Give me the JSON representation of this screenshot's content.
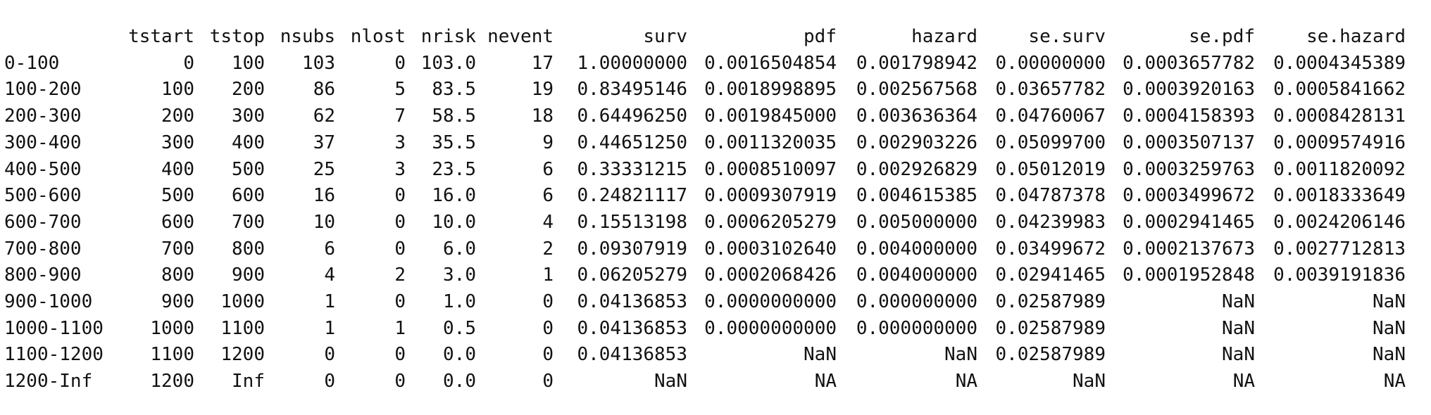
{
  "table": {
    "columns": [
      "",
      "tstart",
      "tstop",
      "nsubs",
      "nlost",
      "nrisk",
      "nevent",
      "surv",
      "pdf",
      "hazard",
      "se.surv",
      "se.pdf",
      "se.hazard"
    ],
    "rows": [
      [
        "0-100",
        "0",
        "100",
        "103",
        "0",
        "103.0",
        "17",
        "1.00000000",
        "0.0016504854",
        "0.001798942",
        "0.00000000",
        "0.0003657782",
        "0.0004345389"
      ],
      [
        "100-200",
        "100",
        "200",
        "86",
        "5",
        "83.5",
        "19",
        "0.83495146",
        "0.0018998895",
        "0.002567568",
        "0.03657782",
        "0.0003920163",
        "0.0005841662"
      ],
      [
        "200-300",
        "200",
        "300",
        "62",
        "7",
        "58.5",
        "18",
        "0.64496250",
        "0.0019845000",
        "0.003636364",
        "0.04760067",
        "0.0004158393",
        "0.0008428131"
      ],
      [
        "300-400",
        "300",
        "400",
        "37",
        "3",
        "35.5",
        "9",
        "0.44651250",
        "0.0011320035",
        "0.002903226",
        "0.05099700",
        "0.0003507137",
        "0.0009574916"
      ],
      [
        "400-500",
        "400",
        "500",
        "25",
        "3",
        "23.5",
        "6",
        "0.33331215",
        "0.0008510097",
        "0.002926829",
        "0.05012019",
        "0.0003259763",
        "0.0011820092"
      ],
      [
        "500-600",
        "500",
        "600",
        "16",
        "0",
        "16.0",
        "6",
        "0.24821117",
        "0.0009307919",
        "0.004615385",
        "0.04787378",
        "0.0003499672",
        "0.0018333649"
      ],
      [
        "600-700",
        "600",
        "700",
        "10",
        "0",
        "10.0",
        "4",
        "0.15513198",
        "0.0006205279",
        "0.005000000",
        "0.04239983",
        "0.0002941465",
        "0.0024206146"
      ],
      [
        "700-800",
        "700",
        "800",
        "6",
        "0",
        "6.0",
        "2",
        "0.09307919",
        "0.0003102640",
        "0.004000000",
        "0.03499672",
        "0.0002137673",
        "0.0027712813"
      ],
      [
        "800-900",
        "800",
        "900",
        "4",
        "2",
        "3.0",
        "1",
        "0.06205279",
        "0.0002068426",
        "0.004000000",
        "0.02941465",
        "0.0001952848",
        "0.0039191836"
      ],
      [
        "900-1000",
        "900",
        "1000",
        "1",
        "0",
        "1.0",
        "0",
        "0.04136853",
        "0.0000000000",
        "0.000000000",
        "0.02587989",
        "NaN",
        "NaN"
      ],
      [
        "1000-1100",
        "1000",
        "1100",
        "1",
        "1",
        "0.5",
        "0",
        "0.04136853",
        "0.0000000000",
        "0.000000000",
        "0.02587989",
        "NaN",
        "NaN"
      ],
      [
        "1100-1200",
        "1100",
        "1200",
        "0",
        "0",
        "0.0",
        "0",
        "0.04136853",
        "NaN",
        "NaN",
        "0.02587989",
        "NaN",
        "NaN"
      ],
      [
        "1200-Inf",
        "1200",
        "Inf",
        "0",
        "0",
        "0.0",
        "0",
        "NaN",
        "NA",
        "NA",
        "NaN",
        "NA",
        "NA"
      ]
    ]
  }
}
